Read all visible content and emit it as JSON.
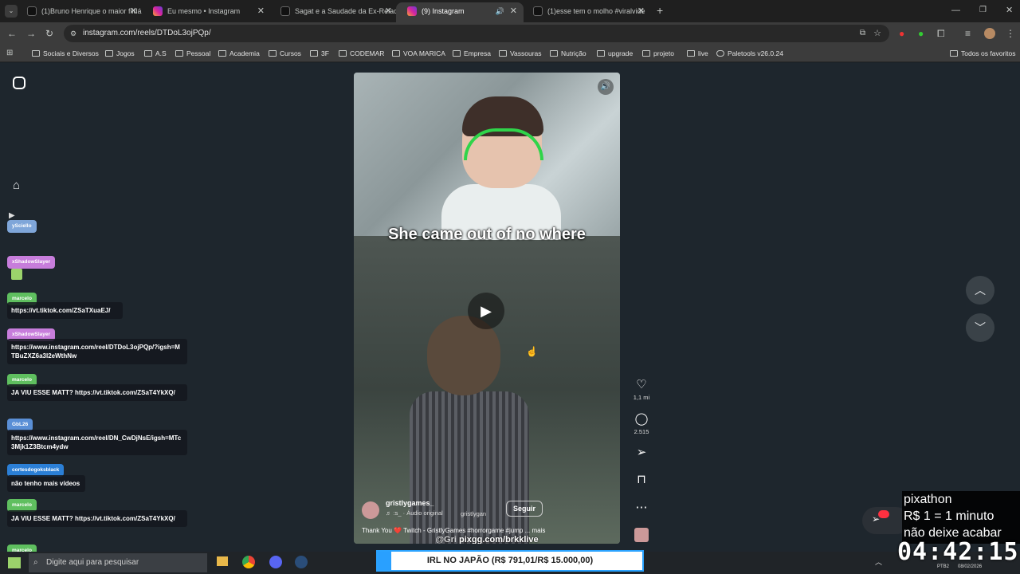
{
  "browser": {
    "tabs": [
      {
        "label": "(1)Bruno Henrique o maior fildá",
        "icon": "tiktok-icon",
        "active": false
      },
      {
        "label": "Eu mesmo • Instagram",
        "icon": "instagram-icon",
        "active": false
      },
      {
        "label": "Sagat e a Saudade da Ex-Relaciç",
        "icon": "tiktok-icon",
        "active": false
      },
      {
        "label": "(9) Instagram",
        "icon": "instagram-icon",
        "active": true
      },
      {
        "label": "(1)esse tem o molho #viralvide",
        "icon": "tiktok-icon",
        "active": false
      }
    ],
    "new_tab_label": "+",
    "url": "instagram.com/reels/DTDoL3ojPQp/",
    "bookmarks": [
      "Sociais e Diversos",
      "Jogos",
      "A.S",
      "Pessoal",
      "Academia",
      "Cursos",
      "3F",
      "CODEMAR",
      "VOA MARICA",
      "Empresa",
      "Vassouras",
      "Nutrição",
      "upgrade",
      "projeto",
      "live",
      "Paletools v26.0.24"
    ],
    "all_bookmarks": "Todos os favoritos"
  },
  "reel": {
    "caption": "She came out of no where",
    "author": "gristlygames_",
    "audio": "♬ :s_ · Áudio original",
    "author_secondary": "gristlygan",
    "follow_label": "Seguir",
    "description": "Thank You ❤️ Twitch - GristlyGames #horrorgame #jump ... mais",
    "overlay_handle": "@Gri",
    "overlay_link": "pixgg.com/brkklive",
    "likes": "1,1 mi",
    "comments": "2.515"
  },
  "chat": [
    {
      "name": "ySciello",
      "color": "#7fa6d9",
      "msg": ""
    },
    {
      "name": "xShadowSlayer",
      "color": "#c77ddb",
      "msg": ""
    },
    {
      "name": "marcelo",
      "color": "#5fbf5f",
      "msg": "https://vt.tiktok.com/ZSaTXuaEJ/"
    },
    {
      "name": "xShadowSlayer",
      "color": "#c77ddb",
      "msg": "https://www.instagram.com/reel/DTDoL3ojPQp/?igsh=MTBuZXZ6a3l2eWthNw"
    },
    {
      "name": "marcelo",
      "color": "#5fbf5f",
      "msg": "JA VIU ESSE MATT? https://vt.tiktok.com/ZSaT4YkXQ/"
    },
    {
      "name": "GbL26",
      "color": "#5a8fd6",
      "msg": "https://www.instagram.com/reel/DN_CwDjNsE/igsh=MTc3Mjk1Z3Btcm4ydw"
    },
    {
      "name": "cortesdogoksblack",
      "color": "#2b7fd6",
      "msg": "não tenho mais vídeos"
    },
    {
      "name": "marcelo",
      "color": "#5fbf5f",
      "msg": "JA VIU ESSE MATT? https://vt.tiktok.com/ZSaT4YkXQ/"
    },
    {
      "name": "marcelo",
      "color": "#5fbf5f",
      "msg": ""
    }
  ],
  "overlay": {
    "goal_text": "IRL NO JAPÃO (R$ 791,01/R$ 15.000,00)",
    "goal_progress": 0.0527,
    "pix_lines": [
      "pixathon",
      "R$ 1 = 1 minuto",
      "não deixe acabar"
    ],
    "timer": "04:42:15"
  },
  "taskbar": {
    "search_placeholder": "Digite aqui para pesquisar",
    "lang": "PTB2",
    "date": "08/02/2026"
  }
}
